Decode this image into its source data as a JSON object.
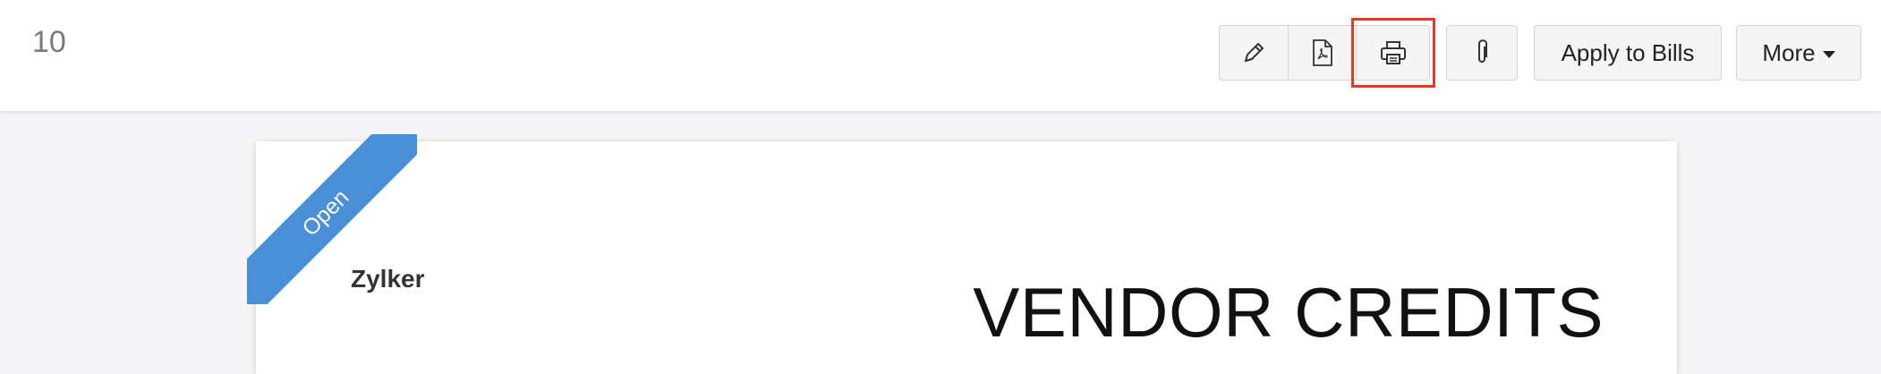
{
  "header": {
    "doc_number": "10",
    "toolbar": {
      "edit_icon": "pencil-icon",
      "pdf_icon": "pdf-icon",
      "print_icon": "printer-icon",
      "attach_icon": "paperclip-icon",
      "apply_label": "Apply to Bills",
      "more_label": "More"
    },
    "highlight_color": "#e03b24"
  },
  "document": {
    "status_ribbon": "Open",
    "ribbon_color": "#4a90d9",
    "company": "Zylker",
    "title": "VENDOR CREDITS"
  }
}
